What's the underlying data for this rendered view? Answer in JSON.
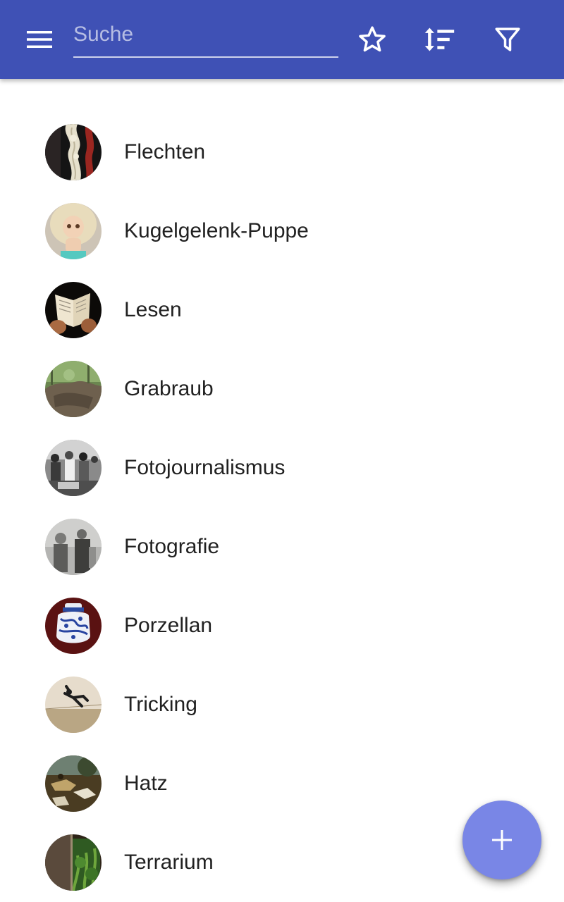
{
  "toolbar": {
    "background_color": "#3f51b5",
    "menu_icon": "menu-icon",
    "search": {
      "placeholder": "Suche",
      "value": ""
    },
    "actions": [
      {
        "icon": "star-outline-icon"
      },
      {
        "icon": "sort-icon"
      },
      {
        "icon": "filter-icon"
      }
    ]
  },
  "list": {
    "items": [
      {
        "label": "Flechten",
        "avatar": "braided-yarn-photo"
      },
      {
        "label": "Kugelgelenk-Puppe",
        "avatar": "doll-photo"
      },
      {
        "label": "Lesen",
        "avatar": "open-book-photo"
      },
      {
        "label": "Grabraub",
        "avatar": "forest-grave-photo"
      },
      {
        "label": "Fotojournalismus",
        "avatar": "crowd-bw-photo"
      },
      {
        "label": "Fotografie",
        "avatar": "vintage-portrait-photo"
      },
      {
        "label": "Porzellan",
        "avatar": "porcelain-jar-photo"
      },
      {
        "label": "Tricking",
        "avatar": "acrobat-jump-photo"
      },
      {
        "label": "Hatz",
        "avatar": "hunting-painting-photo"
      },
      {
        "label": "Terrarium",
        "avatar": "terrarium-photo"
      }
    ]
  },
  "fab": {
    "icon": "plus-icon",
    "background_color": "#7986e6"
  }
}
